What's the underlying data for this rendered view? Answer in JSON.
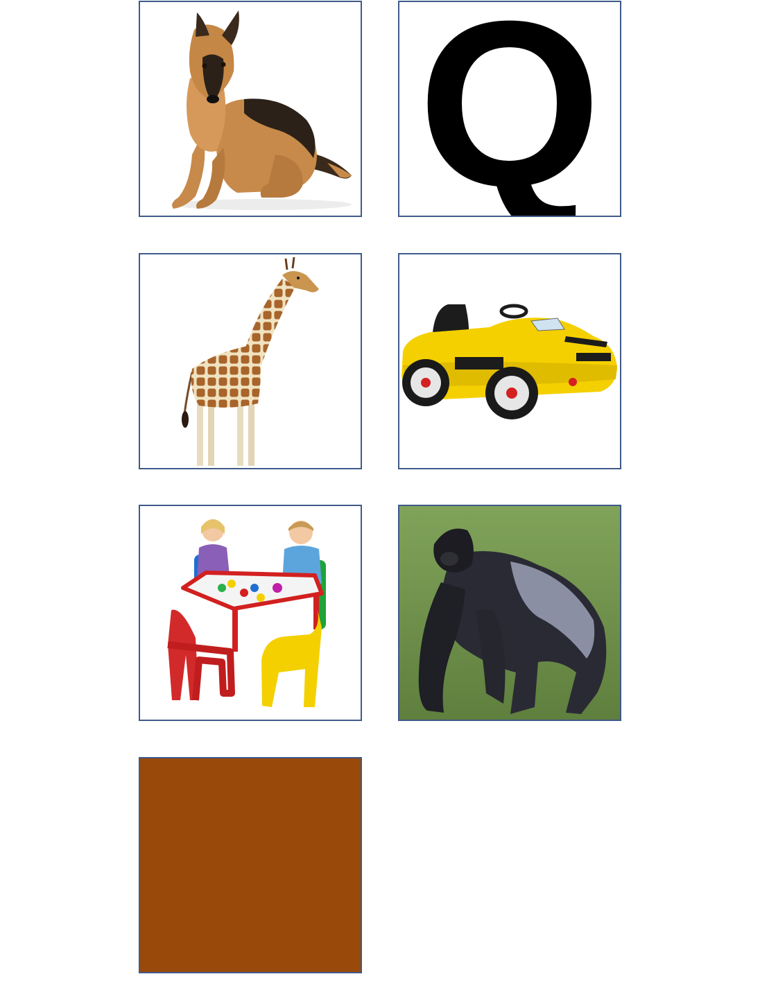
{
  "cards": [
    {
      "id": "dog",
      "icon": "german-shepherd-dog-photo"
    },
    {
      "id": "letter-q",
      "icon": "letter-q-glyph",
      "letter": "Q",
      "color": "#000000"
    },
    {
      "id": "giraffe",
      "icon": "giraffe-photo"
    },
    {
      "id": "toy-car",
      "icon": "yellow-toy-car-photo"
    },
    {
      "id": "kids-table",
      "icon": "children-at-play-table-photo"
    },
    {
      "id": "gorilla",
      "icon": "gorilla-photo"
    },
    {
      "id": "brown-swatch",
      "icon": "brown-color-swatch",
      "color": "#99490a"
    }
  ],
  "colors": {
    "border": "#3f5a8a",
    "swatch_brown": "#99490a",
    "car_yellow": "#f5d000",
    "grass": "#6f8f4a"
  }
}
